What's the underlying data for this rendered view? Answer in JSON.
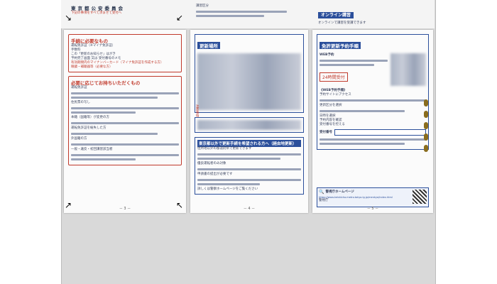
{
  "top": {
    "left_heading": "東京都公安委員会",
    "left_red": "下記の事項をすべて済ませて受付へ",
    "mid_header": "講習区分",
    "online_badge": "オンライン講習",
    "online_note": "オンラインで講習を受講できます"
  },
  "page1": {
    "section1_title": "手続に必要なもの",
    "items": [
      "運転免許証（※マイナ免許証）",
      "手数料",
      "この「更新のお知らせ」はがき",
      "予約完了画面 又は 受付番号のメモ",
      "有効期間内のマイナンバーカード（マイナ免許証を作成する方）",
      "眼鏡・補聴器等（必要な方）"
    ],
    "section2_title": "必要に応じてお持ちいただくもの",
    "body_lines": [
      "運転免許証",
      "住民票の写し",
      "本籍（国籍等）が変更の方",
      "運転免許証を紛失した方",
      "外国籍の方",
      "一般・違反・初回講習該当者"
    ],
    "page_number": "－ 3 －"
  },
  "page2": {
    "section1_title": "更新場所",
    "vertical_label": "注意事項",
    "banner": "東京都以外で更新手続を希望される方へ（経由地更新）",
    "body_lines": [
      "住所地以外の都道府県で更新できます",
      "優良運転者のみ対象",
      "申請書の提出が必要です",
      "詳しくは警察ホームページをご覧ください"
    ],
    "page_number": "－ 4 －"
  },
  "page3": {
    "section1_title": "免許更新予約手順",
    "web_label": "WEB予約",
    "badge": "24時間受付",
    "web_steps_title": "《WEB予約手順》",
    "steps": [
      "予約サイトにアクセス",
      "更新区分を選択",
      "日時を選択",
      "予約内容を確認",
      "受付番号を控える"
    ],
    "reception_label": "受付番号",
    "footer_label": "警視庁ホームページ",
    "footer_url": "https://www.keishicho.metro.tokyo.lg.jp/menkyo/index.html",
    "footer_icon": "search-icon",
    "footer_sub": "警視庁",
    "page_number": "－ 5 －"
  },
  "colors": {
    "red": "#c0392b",
    "blue": "#2b4f9b",
    "navy": "#1d2a44",
    "tab": "#8a6d1e"
  }
}
